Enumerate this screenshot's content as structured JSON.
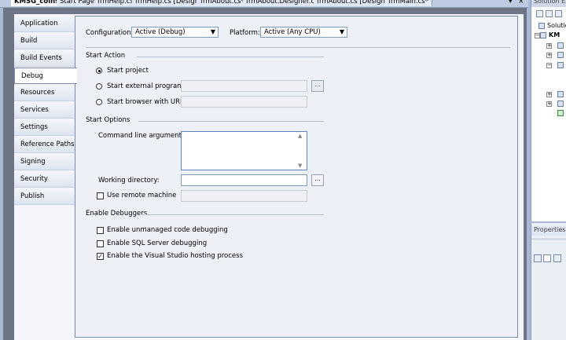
{
  "document_tabs": [
    "KMSG_coins",
    "Start Page",
    "frmHelp.cs",
    "frmHelp.cs [Design]",
    "frmAbout.cs*",
    "frmAbout.Designer.cs",
    "frmAbout.cs [Design]*",
    "frmMain.cs*"
  ],
  "tab_controls": {
    "dropdown": "▾",
    "close": "×"
  },
  "side_tabs": [
    "Application",
    "Build",
    "Build Events",
    "Debug",
    "Resources",
    "Services",
    "Settings",
    "Reference Paths",
    "Signing",
    "Security",
    "Publish"
  ],
  "active_side_tab": "Debug",
  "configuration": {
    "label": "Configuration:",
    "value": "Active (Debug)"
  },
  "platform": {
    "label": "Platform:",
    "value": "Active (Any CPU)"
  },
  "start_action": {
    "title": "Start Action",
    "options": [
      {
        "label": "Start project",
        "selected": true
      },
      {
        "label": "Start external program:",
        "selected": false
      },
      {
        "label": "Start browser with URL:",
        "selected": false
      }
    ],
    "browse_label": "..."
  },
  "start_options": {
    "title": "Start Options",
    "command_line_label": "Command line arguments:",
    "working_dir_label": "Working directory:",
    "remote_machine_label": "Use remote machine",
    "browse_label": "..."
  },
  "enable_debuggers": {
    "title": "Enable Debuggers",
    "options": [
      {
        "label": "Enable unmanaged code debugging",
        "checked": false
      },
      {
        "label": "Enable SQL Server debugging",
        "checked": false
      },
      {
        "label": "Enable the Visual Studio hosting process",
        "checked": true
      }
    ]
  },
  "solution_explorer": {
    "title": "Solution Ex",
    "items": [
      "Solutio",
      "KM"
    ]
  },
  "properties_panel": {
    "title": "Properties"
  }
}
